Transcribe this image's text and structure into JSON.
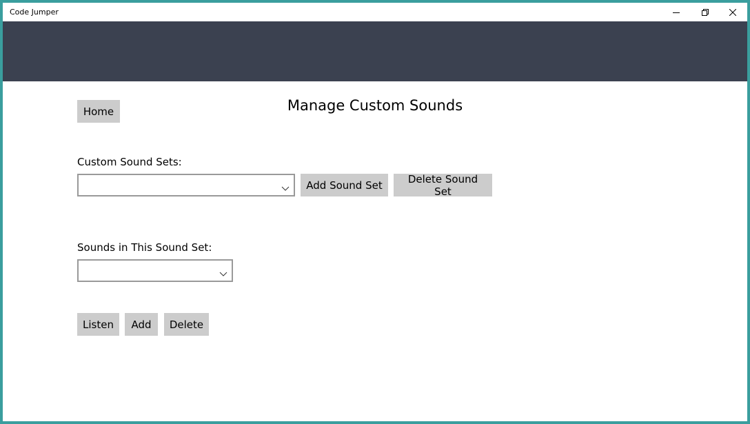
{
  "window": {
    "title": "Code Jumper",
    "controls": {
      "minimize_icon": "minimize-icon",
      "restore_icon": "restore-icon",
      "close_icon": "close-icon"
    }
  },
  "colors": {
    "border": "#3a9e9e",
    "header_band": "#3b4150",
    "button_bg": "#cccccc",
    "combo_border": "#999999"
  },
  "page": {
    "title": "Manage Custom Sounds",
    "home_button": "Home"
  },
  "sound_sets": {
    "label": "Custom Sound Sets:",
    "selected": "",
    "add_button": "Add Sound Set",
    "delete_button": "Delete Sound Set"
  },
  "sounds": {
    "label": "Sounds in This Sound Set:",
    "selected": "",
    "listen_button": "Listen",
    "add_button": "Add",
    "delete_button": "Delete"
  }
}
